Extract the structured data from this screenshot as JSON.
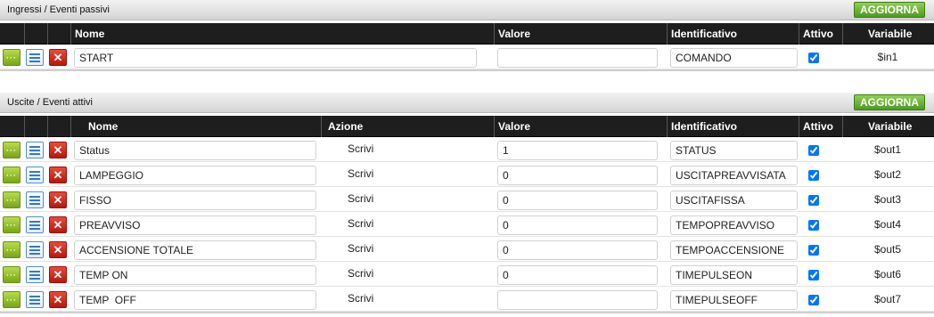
{
  "inputs_section": {
    "title": "Ingressi / Eventi passivi",
    "refresh_label": "AGGIORNA",
    "columns": {
      "name": "Nome",
      "value": "Valore",
      "identifier": "Identificativo",
      "active": "Attivo",
      "variable": "Variabile"
    },
    "rows": [
      {
        "name": "START",
        "value": "",
        "identifier": "COMANDO",
        "active": true,
        "variable": "$in1"
      }
    ]
  },
  "outputs_section": {
    "title": "Uscite / Eventi attivi",
    "refresh_label": "AGGIORNA",
    "columns": {
      "name": "Nome",
      "action": "Azione",
      "value": "Valore",
      "identifier": "Identificativo",
      "active": "Attivo",
      "variable": "Variabile"
    },
    "rows": [
      {
        "name": "Status",
        "action": "Scrivi",
        "value": "1",
        "identifier": "STATUS",
        "active": true,
        "variable": "$out1"
      },
      {
        "name": "LAMPEGGIO",
        "action": "Scrivi",
        "value": "0",
        "identifier": "USCITAPREAVVISATA",
        "active": true,
        "variable": "$out2"
      },
      {
        "name": "FISSO",
        "action": "Scrivi",
        "value": "0",
        "identifier": "USCITAFISSA",
        "active": true,
        "variable": "$out3"
      },
      {
        "name": "PREAVVISO",
        "action": "Scrivi",
        "value": "0",
        "identifier": "TEMPOPREAVVISO",
        "active": true,
        "variable": "$out4"
      },
      {
        "name": "ACCENSIONE TOTALE",
        "action": "Scrivi",
        "value": "0",
        "identifier": "TEMPOACCENSIONE",
        "active": true,
        "variable": "$out5"
      },
      {
        "name": "TEMP ON",
        "action": "Scrivi",
        "value": "0",
        "identifier": "TIMEPULSEON",
        "active": true,
        "variable": "$out6"
      },
      {
        "name": "TEMP  OFF",
        "action": "Scrivi",
        "value": "",
        "identifier": "TIMEPULSEOFF",
        "active": true,
        "variable": "$out7"
      }
    ]
  },
  "icons": {
    "edit": "dots-icon",
    "details": "list-icon",
    "delete": "close-icon"
  },
  "colors": {
    "refresh_button": "#5aa82a",
    "header_bar": "#1e1e1e",
    "edit_button": "#9cc532",
    "details_button": "#2d7ad3",
    "delete_button": "#d1291b"
  }
}
